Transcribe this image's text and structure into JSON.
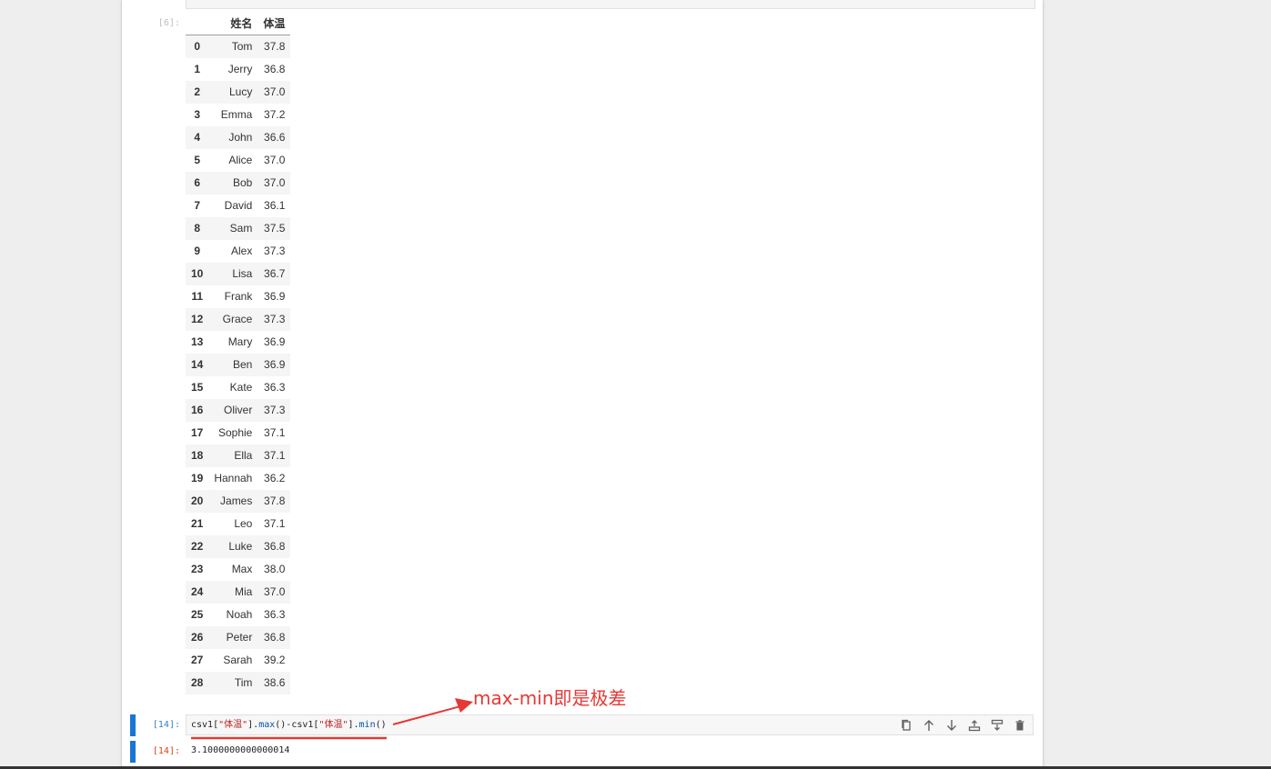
{
  "prev_cell": {
    "output_prompt": "[6]:"
  },
  "dataframe": {
    "columns": [
      "姓名",
      "体温"
    ],
    "rows": [
      {
        "index": "0",
        "name": "Tom",
        "temp": "37.8"
      },
      {
        "index": "1",
        "name": "Jerry",
        "temp": "36.8"
      },
      {
        "index": "2",
        "name": "Lucy",
        "temp": "37.0"
      },
      {
        "index": "3",
        "name": "Emma",
        "temp": "37.2"
      },
      {
        "index": "4",
        "name": "John",
        "temp": "36.6"
      },
      {
        "index": "5",
        "name": "Alice",
        "temp": "37.0"
      },
      {
        "index": "6",
        "name": "Bob",
        "temp": "37.0"
      },
      {
        "index": "7",
        "name": "David",
        "temp": "36.1"
      },
      {
        "index": "8",
        "name": "Sam",
        "temp": "37.5"
      },
      {
        "index": "9",
        "name": "Alex",
        "temp": "37.3"
      },
      {
        "index": "10",
        "name": "Lisa",
        "temp": "36.7"
      },
      {
        "index": "11",
        "name": "Frank",
        "temp": "36.9"
      },
      {
        "index": "12",
        "name": "Grace",
        "temp": "37.3"
      },
      {
        "index": "13",
        "name": "Mary",
        "temp": "36.9"
      },
      {
        "index": "14",
        "name": "Ben",
        "temp": "36.9"
      },
      {
        "index": "15",
        "name": "Kate",
        "temp": "36.3"
      },
      {
        "index": "16",
        "name": "Oliver",
        "temp": "37.3"
      },
      {
        "index": "17",
        "name": "Sophie",
        "temp": "37.1"
      },
      {
        "index": "18",
        "name": "Ella",
        "temp": "37.1"
      },
      {
        "index": "19",
        "name": "Hannah",
        "temp": "36.2"
      },
      {
        "index": "20",
        "name": "James",
        "temp": "37.8"
      },
      {
        "index": "21",
        "name": "Leo",
        "temp": "37.1"
      },
      {
        "index": "22",
        "name": "Luke",
        "temp": "36.8"
      },
      {
        "index": "23",
        "name": "Max",
        "temp": "38.0"
      },
      {
        "index": "24",
        "name": "Mia",
        "temp": "37.0"
      },
      {
        "index": "25",
        "name": "Noah",
        "temp": "36.3"
      },
      {
        "index": "26",
        "name": "Peter",
        "temp": "36.8"
      },
      {
        "index": "27",
        "name": "Sarah",
        "temp": "39.2"
      },
      {
        "index": "28",
        "name": "Tim",
        "temp": "38.6"
      }
    ]
  },
  "code_cell": {
    "input_prompt": "[14]:",
    "code_parts": {
      "p1": "csv1[",
      "s1": "\"体温\"",
      "p2": "].",
      "f1": "max",
      "p3": "()-csv1[",
      "s2": "\"体温\"",
      "p4": "].",
      "f2": "min",
      "p5": "()"
    },
    "output_prompt": "[14]:",
    "output_value": "3.1000000000000014"
  },
  "toolbar": {
    "buttons": [
      "copy-icon",
      "move-up-icon",
      "move-down-icon",
      "insert-above-icon",
      "insert-below-icon",
      "delete-icon"
    ]
  },
  "annotation": {
    "text": "max-min即是极差",
    "color": "#e53935"
  },
  "colors": {
    "prompt_in": "#307fc1",
    "prompt_out": "#d84315",
    "collapser": "#1976d2"
  }
}
